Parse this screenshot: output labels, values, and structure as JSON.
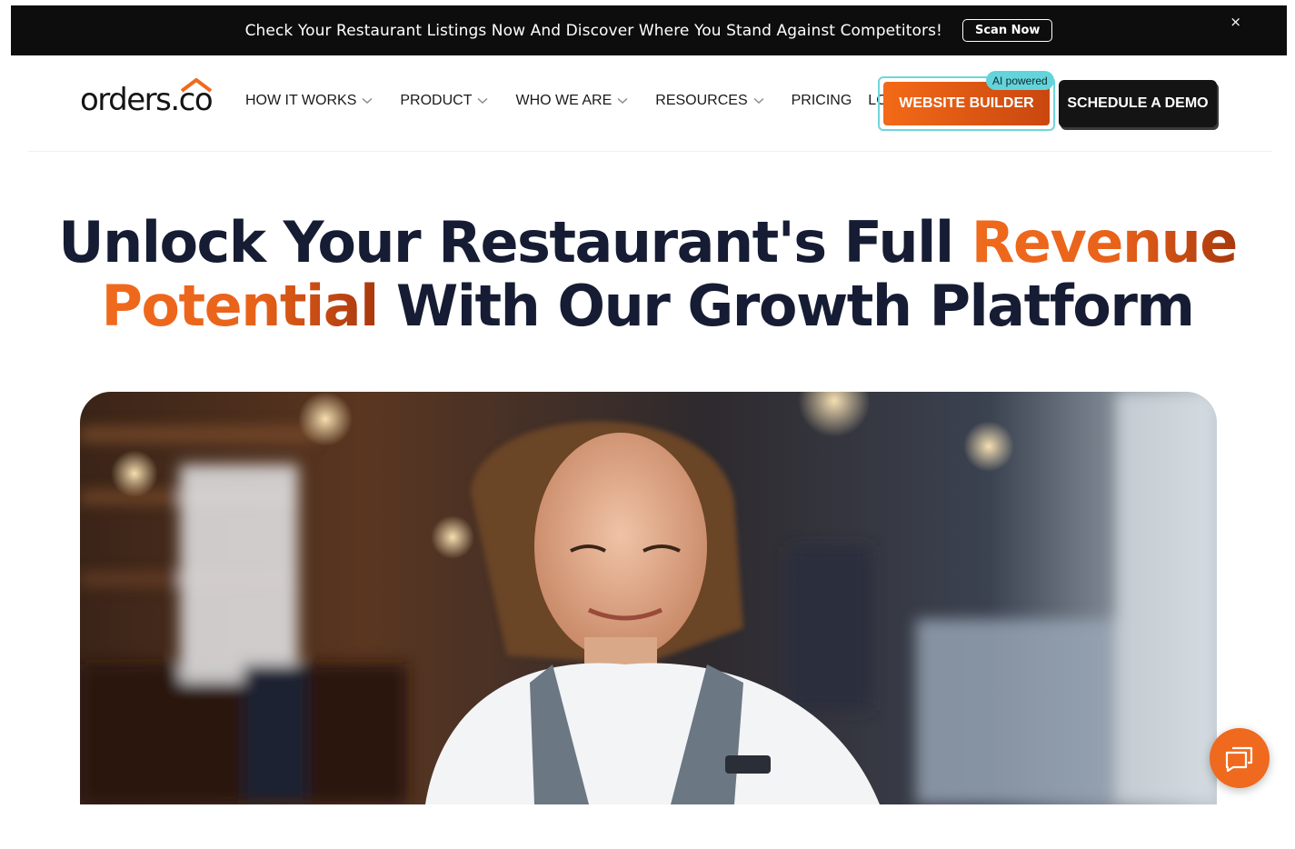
{
  "announcement": {
    "text": "Check Your Restaurant Listings Now And Discover Where You Stand Against Competitors!",
    "cta_label": "Scan Now",
    "close_icon": "close-icon",
    "close_glyph": "×"
  },
  "header": {
    "logo_text": "orders.co",
    "nav": [
      {
        "label": "HOW IT WORKS",
        "has_dropdown": true
      },
      {
        "label": "PRODUCT",
        "has_dropdown": true
      },
      {
        "label": "WHO WE ARE",
        "has_dropdown": true
      },
      {
        "label": "RESOURCES",
        "has_dropdown": true
      },
      {
        "label": "PRICING",
        "has_dropdown": false
      },
      {
        "label": "LOGIN",
        "has_dropdown": false
      }
    ],
    "website_builder_label": "WEBSITE BUILDER",
    "ai_badge": "AI powered",
    "schedule_demo_label": "SCHEDULE A DEMO"
  },
  "hero": {
    "title_line1_plain": "Unlock Your Restaurant's Full ",
    "title_line1_accent": "Revenue",
    "title_line2_accent": "Potential",
    "title_line2_plain": " With Our Growth Platform",
    "image_icon": "hero-photo-restaurant-server"
  },
  "chat": {
    "icon": "chat-bubbles-icon"
  },
  "colors": {
    "accent_orange": "#f06a1d",
    "dark_navy": "#151c33",
    "badge_teal": "#63d4dc",
    "announce_bg": "#0d0d0d"
  }
}
